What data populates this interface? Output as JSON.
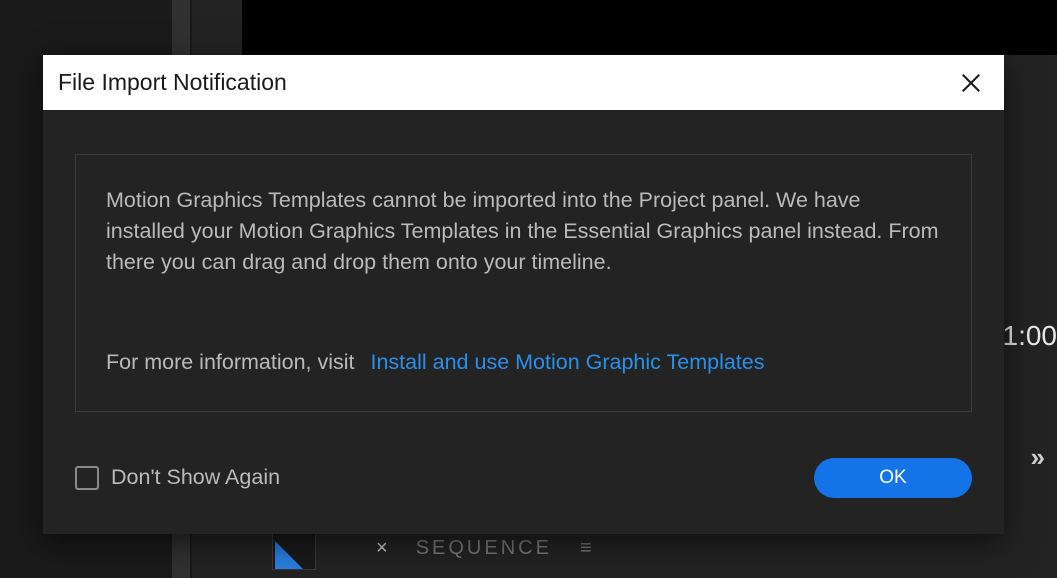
{
  "background": {
    "timecode": "1:00",
    "sequence_label": "SEQUENCE"
  },
  "dialog": {
    "title": "File Import Notification",
    "message": "Motion Graphics Templates cannot be imported into the Project panel. We have installed your Motion Graphics Templates in the Essential Graphics panel instead. From there you can drag and drop them onto your timeline.",
    "info_prefix": "For more information, visit",
    "link_text": "Install and use Motion Graphic Templates",
    "checkbox_label": "Don't Show Again",
    "ok_label": "OK"
  }
}
